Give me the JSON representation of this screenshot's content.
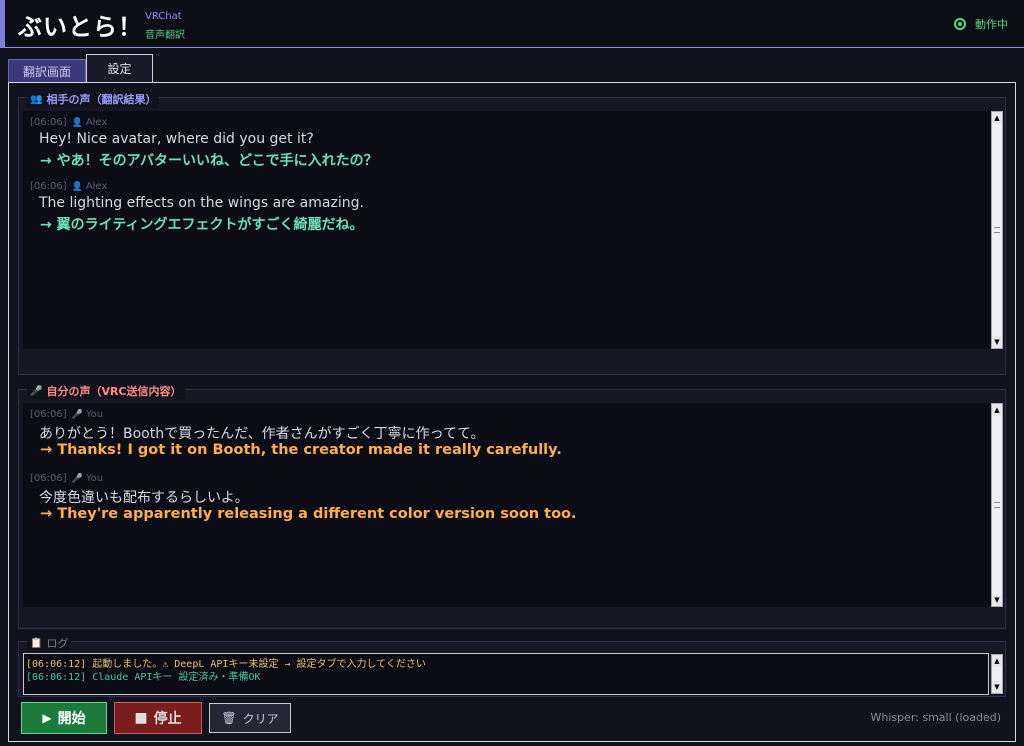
{
  "header": {
    "title": "ぶいとら！",
    "sub1": "VRChat",
    "sub2": "音声翻訳",
    "status": "動作中"
  },
  "tabs": [
    {
      "label": "翻訳画面"
    },
    {
      "label": "設定"
    }
  ],
  "partner": {
    "label": "相手の声（翻訳結果）",
    "messages": [
      {
        "time": "[06:06]",
        "user": "Alex",
        "original": "Hey! Nice avatar, where did you get it?",
        "translation": "→ やあ！そのアバターいいね、どこで手に入れたの？"
      },
      {
        "time": "[06:06]",
        "user": "Alex",
        "original": "The lighting effects on the wings are amazing.",
        "translation": "→ 翼のライティングエフェクトがすごく綺麗だね。"
      }
    ]
  },
  "me": {
    "label": "自分の声（VRC送信内容）",
    "messages": [
      {
        "time": "[06:06]",
        "user": "You",
        "original": "ありがとう！Boothで買ったんだ、作者さんがすごく丁寧に作ってて。",
        "translation": "→ Thanks! I got it on Booth, the creator made it really carefully."
      },
      {
        "time": "[06:06]",
        "user": "You",
        "original": "今度色違いも配布するらしいよ。",
        "translation": "→ They're apparently releasing a different color version soon too."
      }
    ]
  },
  "log": {
    "label": "ログ",
    "lines": [
      "[06:06:12] 起動しました。⚠ DeepL APIキー未設定 → 設定タブで入力してください",
      "[06:06:12] Claude APIキー 設定済み・準備OK"
    ]
  },
  "buttons": {
    "start": "開始",
    "stop": "停止",
    "clear": "クリア"
  },
  "whisper_status": "Whisper: small (loaded)",
  "colors": {
    "accent": "#7f7fd8",
    "partner_translation": "#6ee0b8",
    "me_translation": "#ffae48",
    "status_ok": "#4cdc82"
  }
}
